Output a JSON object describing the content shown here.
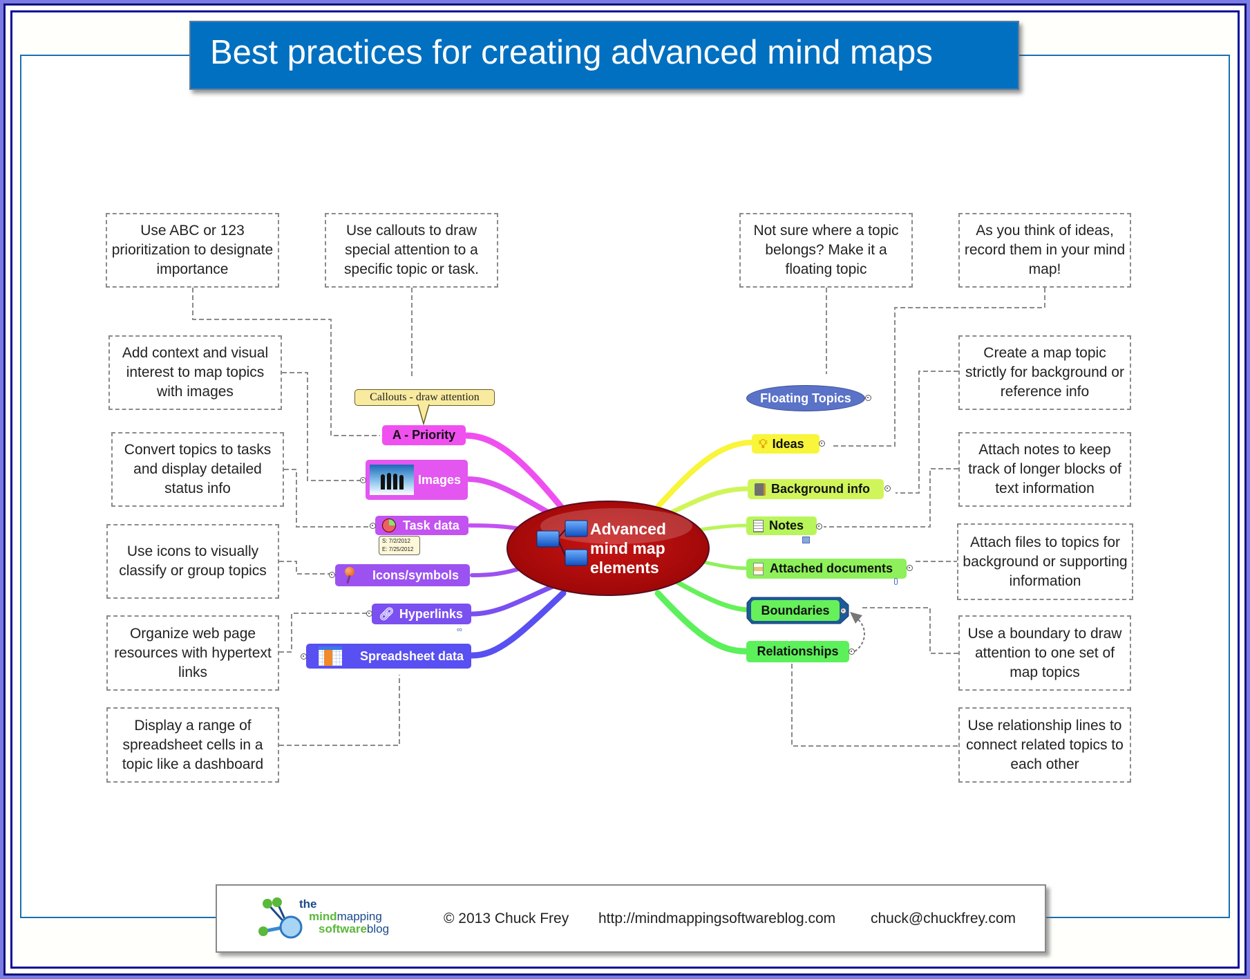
{
  "title": "Best practices for creating advanced mind maps",
  "colors": {
    "title_bg": "#0270c0",
    "central_node": "#b00a0a",
    "left_branch_top": "#f04ff0",
    "left_branch_mid": "#9b4ff0",
    "left_branch_bottom": "#5a50f0",
    "right_branch_yellow": "#f8f53a",
    "right_branch_lime": "#c8f55a",
    "right_branch_green": "#66f05a",
    "floating_topic": "#5a72c8",
    "boundary": "#1c5a98",
    "callout": "#f8eba0",
    "note_border": "#8a8a8a"
  },
  "central_topic": {
    "lines": [
      "Advanced",
      "mind map",
      "elements"
    ],
    "icon": "org-chart-icon"
  },
  "left_topics": [
    {
      "label": "A - Priority",
      "icon": null,
      "color": "#f050f0"
    },
    {
      "label": "Images",
      "icon": "people-image-icon",
      "color": "#e356f0"
    },
    {
      "label": "Task data",
      "icon": "pie-progress-icon",
      "color": "#c352f0"
    },
    {
      "label": "Icons/symbols",
      "icon": "pushpin-icon",
      "color": "#9b52f0"
    },
    {
      "label": "Hyperlinks",
      "icon": "link-icon",
      "color": "#7a50f0"
    },
    {
      "label": "Spreadsheet data",
      "icon": "spreadsheet-icon",
      "color": "#5850f0"
    }
  ],
  "right_topics": [
    {
      "label": "Ideas",
      "icon": "lightbulb-icon",
      "color": "#f8f53a"
    },
    {
      "label": "Background info",
      "icon": "book-icon",
      "color": "#d0f55a"
    },
    {
      "label": "Notes",
      "icon": "notepad-icon",
      "color": "#b8f55a"
    },
    {
      "label": "Attached documents",
      "icon": "document-icon",
      "color": "#8ef05a"
    },
    {
      "label": "Boundaries",
      "icon": null,
      "color": "#66f05a"
    },
    {
      "label": "Relationships",
      "icon": null,
      "color": "#5cf05a"
    }
  ],
  "floating_topic": {
    "label": "Floating Topics"
  },
  "callout": {
    "label": "Callouts - draw attention"
  },
  "task_info": {
    "start": "S: 7/2/2012",
    "end": "E: 7/25/2012"
  },
  "left_notes": [
    "Use ABC or 123 prioritization to designate importance",
    "Use callouts to draw special attention to a specific topic or task.",
    "Add context and visual interest to map topics with images",
    "Convert topics to tasks and display detailed status info",
    "Use icons to visually classify or group topics",
    "Organize web page resources with hypertext links",
    "Display a range of spreadsheet cells in a topic like a dashboard"
  ],
  "right_notes": [
    "Not sure where a topic belongs? Make it a floating topic",
    "As you think of ideas, record them in your mind map!",
    "Create a map topic strictly for background or reference info",
    "Attach notes to keep track of longer blocks of text information",
    "Attach files to topics for background or supporting information",
    "Use a boundary to draw attention to one set of map topics",
    "Use relationship lines to connect related topics to each other"
  ],
  "footer": {
    "logo": {
      "line1": "the",
      "line2a": "mind",
      "line2b": "mapping",
      "line3a": "software",
      "line3b": "blog"
    },
    "copyright": "© 2013 Chuck Frey",
    "url": "http://mindmappingsoftwareblog.com",
    "email": "chuck@chuckfrey.com"
  }
}
